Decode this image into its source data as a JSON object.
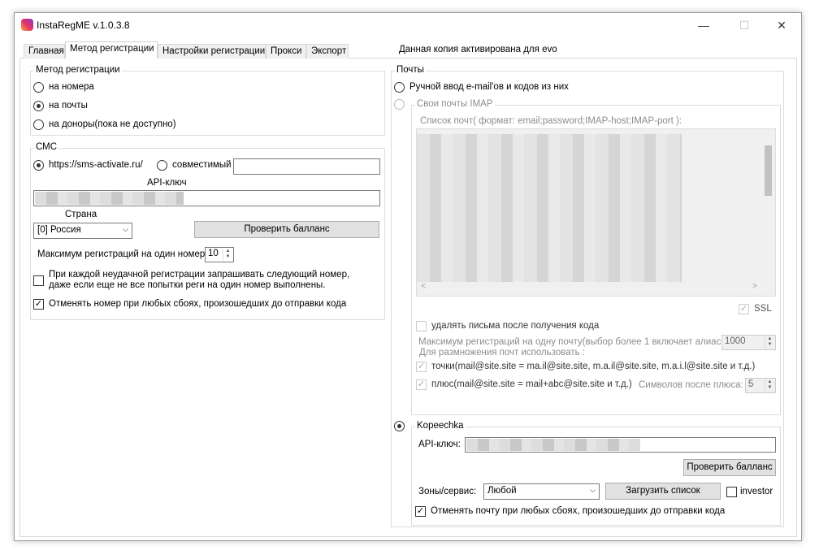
{
  "window": {
    "title": "InstaRegME  v.1.0.3.8",
    "minimize": "—",
    "maximize": "☐",
    "close": "✕"
  },
  "activation": "Данная копия активирована для evo",
  "tabs": [
    "Главная",
    "Метод регистрации",
    "Настройки регистрации",
    "Прокси",
    "Экспорт"
  ],
  "method": {
    "label": "Метод регистрации",
    "options": [
      "на номера",
      "на почты",
      "на доноры(пока не доступно)"
    ],
    "selected": 1
  },
  "sms": {
    "label": "СМС",
    "service1": "https://sms-activate.ru/",
    "service2": "совместимый",
    "service2_value": "",
    "api_label": "API-ключ",
    "country_label": "Страна",
    "country": "[0] Россия",
    "check_balance": "Проверить балланс",
    "max_label": "Максимум регистраций на один номер",
    "max_value": "10",
    "retry_line1": "При каждой неудачной регистрации запрашивать следующий номер,",
    "retry_line2": "даже если еще не все попытки реги на один номер выполнены.",
    "retry_checked": false,
    "cancel_label": "Отменять номер при любых сбоях, произошедших до отправки кода",
    "cancel_checked": true
  },
  "mails": {
    "label": "Почты",
    "manual": "Ручной ввод e-mail'ов и кодов из них",
    "imap": {
      "label": "Свои почты IMAP",
      "list_label": "Список почт( формат: email;password;IMAP-host;IMAP-port ):",
      "ssl": "SSL",
      "delete": "удалять письма после получения кода",
      "max_label": "Максимум регистраций на одну почту(выбор более 1 включает алиасы):",
      "max_value": "1000",
      "multiply_label": "Для размножения почт использовать :",
      "dots": "точки(mail@site.site = ma.il@site.site, m.a.il@site.site, m.a.i.l@site.site и т.д.)",
      "plus": "плюс(mail@site.site = mail+abc@site.site и т.д.)",
      "plus_chars_label": "Символов после плюса:",
      "plus_chars": "5"
    },
    "kopeechka": {
      "label": "Kopeechka",
      "api_label": "API-ключ:",
      "check_balance": "Проверить балланс",
      "zones_label": "Зоны/сервис:",
      "zone": "Любой",
      "load_list": "Загрузить список",
      "investor": "investor",
      "cancel_label": "Отменять почту при любых сбоях, произошедших до отправки кода",
      "cancel_checked": true
    }
  }
}
